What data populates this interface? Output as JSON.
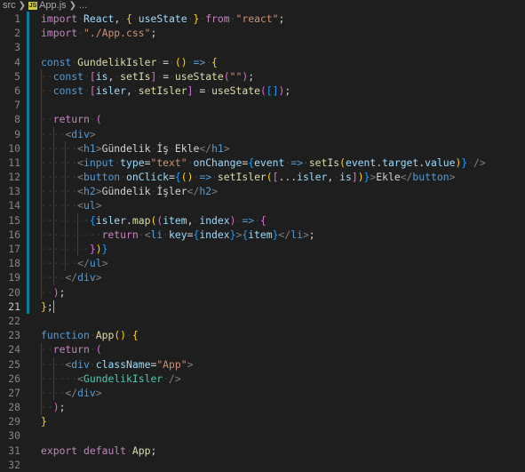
{
  "breadcrumb": {
    "folder": "src",
    "file_badge": "JS",
    "file": "App.js",
    "more": "..."
  },
  "editor": {
    "language": "javascript",
    "current_line": 21,
    "lines": [
      {
        "n": "1",
        "tokens": [
          [
            "ctl",
            "import"
          ],
          [
            "",
            "·"
          ],
          [
            "var",
            "React"
          ],
          [
            "",
            ",·"
          ],
          [
            "br1",
            "{"
          ],
          [
            "",
            "·"
          ],
          [
            "var",
            "useState"
          ],
          [
            "",
            "·"
          ],
          [
            "br1",
            "}"
          ],
          [
            "",
            "·"
          ],
          [
            "ctl",
            "from"
          ],
          [
            "",
            "·"
          ],
          [
            "str",
            "\"react\""
          ],
          [
            "",
            ";"
          ]
        ]
      },
      {
        "n": "2",
        "tokens": [
          [
            "ctl",
            "import"
          ],
          [
            "",
            "·"
          ],
          [
            "str",
            "\"./App.css\""
          ],
          [
            "",
            ";"
          ]
        ]
      },
      {
        "n": "3",
        "tokens": []
      },
      {
        "n": "4",
        "tokens": [
          [
            "kw",
            "const"
          ],
          [
            "",
            "·"
          ],
          [
            "fn",
            "GundelikIsler"
          ],
          [
            "",
            "·=·"
          ],
          [
            "br1",
            "("
          ],
          [
            "br1",
            ")"
          ],
          [
            "",
            "·"
          ],
          [
            "kw",
            "=>"
          ],
          [
            "",
            "·"
          ],
          [
            "br1",
            "{"
          ]
        ]
      },
      {
        "n": "5",
        "tokens": [
          [
            "dot",
            "··"
          ],
          [
            "kw",
            "const"
          ],
          [
            "",
            "·"
          ],
          [
            "br2",
            "["
          ],
          [
            "var",
            "is"
          ],
          [
            "",
            ",·"
          ],
          [
            "fn",
            "setIs"
          ],
          [
            "br2",
            "]"
          ],
          [
            "",
            "·=·"
          ],
          [
            "fn",
            "useState"
          ],
          [
            "br2",
            "("
          ],
          [
            "str",
            "\"\""
          ],
          [
            "br2",
            ")"
          ],
          [
            "",
            ";"
          ]
        ]
      },
      {
        "n": "6",
        "tokens": [
          [
            "dot",
            "··"
          ],
          [
            "kw",
            "const"
          ],
          [
            "",
            "·"
          ],
          [
            "br2",
            "["
          ],
          [
            "var",
            "isler"
          ],
          [
            "",
            ",·"
          ],
          [
            "fn",
            "setIsler"
          ],
          [
            "br2",
            "]"
          ],
          [
            "",
            "·=·"
          ],
          [
            "fn",
            "useState"
          ],
          [
            "br2",
            "("
          ],
          [
            "br3",
            "["
          ],
          [
            "br3",
            "]"
          ],
          [
            "br2",
            ")"
          ],
          [
            "",
            ";"
          ]
        ]
      },
      {
        "n": "7",
        "tokens": []
      },
      {
        "n": "8",
        "tokens": [
          [
            "dot",
            "··"
          ],
          [
            "ctl",
            "return"
          ],
          [
            "",
            "·"
          ],
          [
            "br2",
            "("
          ]
        ]
      },
      {
        "n": "9",
        "tokens": [
          [
            "dot",
            "····"
          ],
          [
            "ptag",
            "<"
          ],
          [
            "tag",
            "div"
          ],
          [
            "ptag",
            ">"
          ]
        ]
      },
      {
        "n": "10",
        "tokens": [
          [
            "dot",
            "······"
          ],
          [
            "ptag",
            "<"
          ],
          [
            "tag",
            "h1"
          ],
          [
            "ptag",
            ">"
          ],
          [
            "",
            "Gündelik·İş·Ekle"
          ],
          [
            "ptag",
            "</"
          ],
          [
            "tag",
            "h1"
          ],
          [
            "ptag",
            ">"
          ]
        ]
      },
      {
        "n": "11",
        "tokens": [
          [
            "dot",
            "······"
          ],
          [
            "ptag",
            "<"
          ],
          [
            "tag",
            "input"
          ],
          [
            "",
            "·"
          ],
          [
            "attr",
            "type"
          ],
          [
            "",
            "="
          ],
          [
            "str",
            "\"text\""
          ],
          [
            "",
            "·"
          ],
          [
            "attr",
            "onChange"
          ],
          [
            "",
            "="
          ],
          [
            "br3",
            "{"
          ],
          [
            "var",
            "event"
          ],
          [
            "",
            "·"
          ],
          [
            "kw",
            "=>"
          ],
          [
            "",
            "·"
          ],
          [
            "fn",
            "setIs"
          ],
          [
            "br1",
            "("
          ],
          [
            "var",
            "event"
          ],
          [
            "",
            "."
          ],
          [
            "var",
            "target"
          ],
          [
            "",
            "."
          ],
          [
            "var",
            "value"
          ],
          [
            "br1",
            ")"
          ],
          [
            "br3",
            "}"
          ],
          [
            "",
            "·"
          ],
          [
            "ptag",
            "/>"
          ]
        ]
      },
      {
        "n": "12",
        "tokens": [
          [
            "dot",
            "······"
          ],
          [
            "ptag",
            "<"
          ],
          [
            "tag",
            "button"
          ],
          [
            "",
            "·"
          ],
          [
            "attr",
            "onClick"
          ],
          [
            "",
            "="
          ],
          [
            "br3",
            "{"
          ],
          [
            "br1",
            "("
          ],
          [
            "br1",
            ")"
          ],
          [
            "",
            "·"
          ],
          [
            "kw",
            "=>"
          ],
          [
            "",
            "·"
          ],
          [
            "fn",
            "setIsler"
          ],
          [
            "br1",
            "("
          ],
          [
            "br2",
            "["
          ],
          [
            "",
            "..."
          ],
          [
            "var",
            "isler"
          ],
          [
            "",
            ",·"
          ],
          [
            "var",
            "is"
          ],
          [
            "br2",
            "]"
          ],
          [
            "br1",
            ")"
          ],
          [
            "br3",
            "}"
          ],
          [
            "ptag",
            ">"
          ],
          [
            "",
            "Ekle"
          ],
          [
            "ptag",
            "</"
          ],
          [
            "tag",
            "button"
          ],
          [
            "ptag",
            ">"
          ]
        ]
      },
      {
        "n": "13",
        "tokens": [
          [
            "dot",
            "······"
          ],
          [
            "ptag",
            "<"
          ],
          [
            "tag",
            "h2"
          ],
          [
            "ptag",
            ">"
          ],
          [
            "",
            "Gündelik·İşler"
          ],
          [
            "ptag",
            "</"
          ],
          [
            "tag",
            "h2"
          ],
          [
            "ptag",
            ">"
          ]
        ]
      },
      {
        "n": "14",
        "tokens": [
          [
            "dot",
            "······"
          ],
          [
            "ptag",
            "<"
          ],
          [
            "tag",
            "ul"
          ],
          [
            "ptag",
            ">"
          ]
        ]
      },
      {
        "n": "15",
        "tokens": [
          [
            "dot",
            "········"
          ],
          [
            "br3",
            "{"
          ],
          [
            "var",
            "isler"
          ],
          [
            "",
            "."
          ],
          [
            "fn",
            "map"
          ],
          [
            "br1",
            "("
          ],
          [
            "br2",
            "("
          ],
          [
            "var",
            "item"
          ],
          [
            "",
            ",·"
          ],
          [
            "var",
            "index"
          ],
          [
            "br2",
            ")"
          ],
          [
            "",
            "·"
          ],
          [
            "kw",
            "=>"
          ],
          [
            "",
            "·"
          ],
          [
            "br2",
            "{"
          ]
        ]
      },
      {
        "n": "16",
        "tokens": [
          [
            "dot",
            "··········"
          ],
          [
            "ctl",
            "return"
          ],
          [
            "",
            "·"
          ],
          [
            "ptag",
            "<"
          ],
          [
            "tag",
            "li"
          ],
          [
            "",
            "·"
          ],
          [
            "attr",
            "key"
          ],
          [
            "",
            "="
          ],
          [
            "br3",
            "{"
          ],
          [
            "var",
            "index"
          ],
          [
            "br3",
            "}"
          ],
          [
            "ptag",
            ">"
          ],
          [
            "br3",
            "{"
          ],
          [
            "var",
            "item"
          ],
          [
            "br3",
            "}"
          ],
          [
            "ptag",
            "</"
          ],
          [
            "tag",
            "li"
          ],
          [
            "ptag",
            ">"
          ],
          [
            "",
            ";"
          ]
        ]
      },
      {
        "n": "17",
        "tokens": [
          [
            "dot",
            "········"
          ],
          [
            "br2",
            "}"
          ],
          [
            "br1",
            ")"
          ],
          [
            "br3",
            "}"
          ]
        ]
      },
      {
        "n": "18",
        "tokens": [
          [
            "dot",
            "······"
          ],
          [
            "ptag",
            "</"
          ],
          [
            "tag",
            "ul"
          ],
          [
            "ptag",
            ">"
          ]
        ]
      },
      {
        "n": "19",
        "tokens": [
          [
            "dot",
            "····"
          ],
          [
            "ptag",
            "</"
          ],
          [
            "tag",
            "div"
          ],
          [
            "ptag",
            ">"
          ]
        ]
      },
      {
        "n": "20",
        "tokens": [
          [
            "dot",
            "··"
          ],
          [
            "br2",
            ")"
          ],
          [
            "",
            ";"
          ]
        ]
      },
      {
        "n": "21",
        "tokens": [
          [
            "br1",
            "}"
          ],
          [
            "",
            ";"
          ]
        ]
      },
      {
        "n": "22",
        "tokens": []
      },
      {
        "n": "23",
        "tokens": [
          [
            "kw",
            "function"
          ],
          [
            "",
            "·"
          ],
          [
            "fn",
            "App"
          ],
          [
            "br1",
            "("
          ],
          [
            "br1",
            ")"
          ],
          [
            "",
            "·"
          ],
          [
            "br1",
            "{"
          ]
        ]
      },
      {
        "n": "24",
        "tokens": [
          [
            "dot",
            "··"
          ],
          [
            "ctl",
            "return"
          ],
          [
            "",
            "·"
          ],
          [
            "br2",
            "("
          ]
        ]
      },
      {
        "n": "25",
        "tokens": [
          [
            "dot",
            "····"
          ],
          [
            "ptag",
            "<"
          ],
          [
            "tag",
            "div"
          ],
          [
            "",
            "·"
          ],
          [
            "attr",
            "className"
          ],
          [
            "",
            "="
          ],
          [
            "str",
            "\"App\""
          ],
          [
            "ptag",
            ">"
          ]
        ]
      },
      {
        "n": "26",
        "tokens": [
          [
            "dot",
            "······"
          ],
          [
            "ptag",
            "<"
          ],
          [
            "comp",
            "GundelikIsler"
          ],
          [
            "",
            "·"
          ],
          [
            "ptag",
            "/>"
          ]
        ]
      },
      {
        "n": "27",
        "tokens": [
          [
            "dot",
            "····"
          ],
          [
            "ptag",
            "</"
          ],
          [
            "tag",
            "div"
          ],
          [
            "ptag",
            ">"
          ]
        ]
      },
      {
        "n": "28",
        "tokens": [
          [
            "dot",
            "··"
          ],
          [
            "br2",
            ")"
          ],
          [
            "",
            ";"
          ]
        ]
      },
      {
        "n": "29",
        "tokens": [
          [
            "br1",
            "}"
          ]
        ]
      },
      {
        "n": "30",
        "tokens": []
      },
      {
        "n": "31",
        "tokens": [
          [
            "ctl",
            "export"
          ],
          [
            "",
            "·"
          ],
          [
            "ctl",
            "default"
          ],
          [
            "",
            "·"
          ],
          [
            "fn",
            "App"
          ],
          [
            "",
            ";"
          ]
        ]
      },
      {
        "n": "32",
        "tokens": []
      }
    ]
  }
}
